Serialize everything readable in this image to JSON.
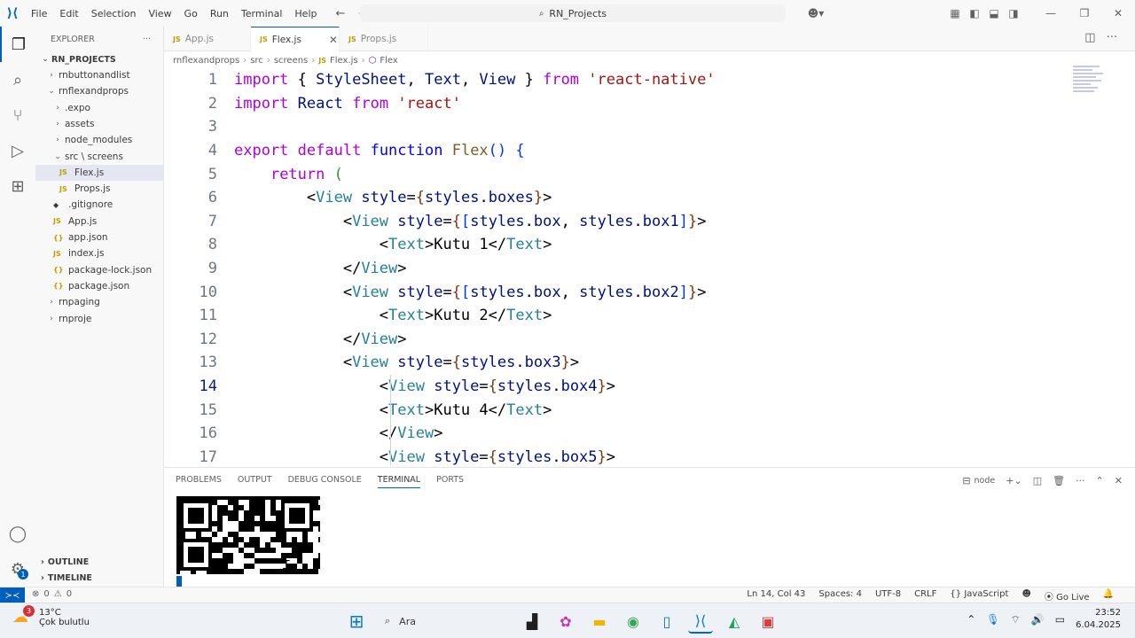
{
  "titlebar": {
    "menu": [
      "File",
      "Edit",
      "Selection",
      "View",
      "Go",
      "Run",
      "Terminal",
      "Help"
    ],
    "search": "RN_Projects"
  },
  "sidebar": {
    "title": "EXPLORER",
    "more": "···",
    "root": "RN_PROJECTS",
    "items": [
      {
        "label": "rnbuttonandlist",
        "indent": 1,
        "chev": "›"
      },
      {
        "label": "rnflexandprops",
        "indent": 1,
        "chev": "⌄"
      },
      {
        "label": ".expo",
        "indent": 2,
        "chev": "›"
      },
      {
        "label": "assets",
        "indent": 2,
        "chev": "›"
      },
      {
        "label": "node_modules",
        "indent": 2,
        "chev": "›"
      },
      {
        "label": "src \\ screens",
        "indent": 2,
        "chev": "⌄"
      },
      {
        "label": "Flex.js",
        "indent": 3,
        "icon": "JS",
        "active": true
      },
      {
        "label": "Props.js",
        "indent": 3,
        "icon": "JS"
      },
      {
        "label": ".gitignore",
        "indent": 2,
        "icon": "◆"
      },
      {
        "label": "App.js",
        "indent": 2,
        "icon": "JS"
      },
      {
        "label": "app.json",
        "indent": 2,
        "icon": "{}"
      },
      {
        "label": "index.js",
        "indent": 2,
        "icon": "JS"
      },
      {
        "label": "package-lock.json",
        "indent": 2,
        "icon": "{}"
      },
      {
        "label": "package.json",
        "indent": 2,
        "icon": "{}"
      },
      {
        "label": "rnpaging",
        "indent": 1,
        "chev": "›"
      },
      {
        "label": "rnproje",
        "indent": 1,
        "chev": "›"
      }
    ],
    "outline": "OUTLINE",
    "timeline": "TIMELINE"
  },
  "tabs": [
    {
      "label": "App.js",
      "icon": "JS",
      "active": false
    },
    {
      "label": "Flex.js",
      "icon": "JS",
      "active": true,
      "close": "✕"
    },
    {
      "label": "Props.js",
      "icon": "JS",
      "active": false
    }
  ],
  "breadcrumb": [
    "rnflexandprops",
    "src",
    "screens",
    "Flex.js",
    "Flex"
  ],
  "breadcrumb_icon": "JS",
  "editor": {
    "current_line": 14,
    "lines": [
      [
        [
          "kw",
          "import"
        ],
        [
          "pl",
          " { "
        ],
        [
          "var",
          "StyleSheet"
        ],
        [
          "pl",
          ", "
        ],
        [
          "var",
          "Text"
        ],
        [
          "pl",
          ", "
        ],
        [
          "var",
          "View"
        ],
        [
          "pl",
          " } "
        ],
        [
          "kw",
          "from"
        ],
        [
          "pl",
          " "
        ],
        [
          "str",
          "'react-native'"
        ]
      ],
      [
        [
          "kw",
          "import"
        ],
        [
          "pl",
          " "
        ],
        [
          "var",
          "React"
        ],
        [
          "pl",
          " "
        ],
        [
          "kw",
          "from"
        ],
        [
          "pl",
          " "
        ],
        [
          "str",
          "'react'"
        ]
      ],
      [],
      [
        [
          "kw",
          "export"
        ],
        [
          "pl",
          " "
        ],
        [
          "kw",
          "default"
        ],
        [
          "pl",
          " "
        ],
        [
          "kwb",
          "function"
        ],
        [
          "pl",
          " "
        ],
        [
          "fn",
          "Flex"
        ],
        [
          "br",
          "()"
        ],
        [
          "pl",
          " "
        ],
        [
          "br",
          "{"
        ]
      ],
      [
        [
          "pl",
          "    "
        ],
        [
          "kw",
          "return"
        ],
        [
          "pl",
          " "
        ],
        [
          "br2",
          "("
        ]
      ],
      [
        [
          "pl",
          "        "
        ],
        [
          "pl",
          "<"
        ],
        [
          "tag",
          "View"
        ],
        [
          "pl",
          " "
        ],
        [
          "var",
          "style"
        ],
        [
          "pl",
          "="
        ],
        [
          "br3",
          "{"
        ],
        [
          "var",
          "styles"
        ],
        [
          "pl",
          "."
        ],
        [
          "var",
          "boxes"
        ],
        [
          "br3",
          "}"
        ],
        [
          "pl",
          ">"
        ]
      ],
      [
        [
          "pl",
          "            "
        ],
        [
          "pl",
          "<"
        ],
        [
          "tag",
          "View"
        ],
        [
          "pl",
          " "
        ],
        [
          "var",
          "style"
        ],
        [
          "pl",
          "="
        ],
        [
          "br3",
          "{"
        ],
        [
          "br",
          "["
        ],
        [
          "var",
          "styles"
        ],
        [
          "pl",
          "."
        ],
        [
          "var",
          "box"
        ],
        [
          "pl",
          ", "
        ],
        [
          "var",
          "styles"
        ],
        [
          "pl",
          "."
        ],
        [
          "var",
          "box1"
        ],
        [
          "br",
          "]"
        ],
        [
          "br3",
          "}"
        ],
        [
          "pl",
          ">"
        ]
      ],
      [
        [
          "pl",
          "                "
        ],
        [
          "pl",
          "<"
        ],
        [
          "tag",
          "Text"
        ],
        [
          "pl",
          ">"
        ],
        [
          "txt",
          "Kutu 1"
        ],
        [
          "pl",
          "</"
        ],
        [
          "tag",
          "Text"
        ],
        [
          "pl",
          ">"
        ]
      ],
      [
        [
          "pl",
          "            "
        ],
        [
          "pl",
          "</"
        ],
        [
          "tag",
          "View"
        ],
        [
          "pl",
          ">"
        ]
      ],
      [
        [
          "pl",
          "            "
        ],
        [
          "pl",
          "<"
        ],
        [
          "tag",
          "View"
        ],
        [
          "pl",
          " "
        ],
        [
          "var",
          "style"
        ],
        [
          "pl",
          "="
        ],
        [
          "br3",
          "{"
        ],
        [
          "br",
          "["
        ],
        [
          "var",
          "styles"
        ],
        [
          "pl",
          "."
        ],
        [
          "var",
          "box"
        ],
        [
          "pl",
          ", "
        ],
        [
          "var",
          "styles"
        ],
        [
          "pl",
          "."
        ],
        [
          "var",
          "box2"
        ],
        [
          "br",
          "]"
        ],
        [
          "br3",
          "}"
        ],
        [
          "pl",
          ">"
        ]
      ],
      [
        [
          "pl",
          "                "
        ],
        [
          "pl",
          "<"
        ],
        [
          "tag",
          "Text"
        ],
        [
          "pl",
          ">"
        ],
        [
          "txt",
          "Kutu 2"
        ],
        [
          "pl",
          "</"
        ],
        [
          "tag",
          "Text"
        ],
        [
          "pl",
          ">"
        ]
      ],
      [
        [
          "pl",
          "            "
        ],
        [
          "pl",
          "</"
        ],
        [
          "tag",
          "View"
        ],
        [
          "pl",
          ">"
        ]
      ],
      [
        [
          "pl",
          "            "
        ],
        [
          "pl",
          "<"
        ],
        [
          "tag",
          "View"
        ],
        [
          "pl",
          " "
        ],
        [
          "var",
          "style"
        ],
        [
          "pl",
          "="
        ],
        [
          "br3",
          "{"
        ],
        [
          "var",
          "styles"
        ],
        [
          "pl",
          "."
        ],
        [
          "var",
          "box3"
        ],
        [
          "br3",
          "}"
        ],
        [
          "pl",
          ">"
        ]
      ],
      [
        [
          "pl",
          "                "
        ],
        [
          "pl",
          "<"
        ],
        [
          "tag",
          "View"
        ],
        [
          "pl",
          " "
        ],
        [
          "var",
          "style"
        ],
        [
          "pl",
          "="
        ],
        [
          "br3",
          "{"
        ],
        [
          "var",
          "styles"
        ],
        [
          "pl",
          "."
        ],
        [
          "var",
          "box4"
        ],
        [
          "br3",
          "}"
        ],
        [
          "pl",
          ">"
        ]
      ],
      [
        [
          "pl",
          "                "
        ],
        [
          "pl",
          "<"
        ],
        [
          "tag",
          "Text"
        ],
        [
          "pl",
          ">"
        ],
        [
          "txt",
          "Kutu 4"
        ],
        [
          "pl",
          "</"
        ],
        [
          "tag",
          "Text"
        ],
        [
          "pl",
          ">"
        ]
      ],
      [
        [
          "pl",
          "                "
        ],
        [
          "pl",
          "</"
        ],
        [
          "tag",
          "View"
        ],
        [
          "pl",
          ">"
        ]
      ],
      [
        [
          "pl",
          "                "
        ],
        [
          "pl",
          "<"
        ],
        [
          "tag",
          "View"
        ],
        [
          "pl",
          " "
        ],
        [
          "var",
          "style"
        ],
        [
          "pl",
          "="
        ],
        [
          "br3",
          "{"
        ],
        [
          "var",
          "styles"
        ],
        [
          "pl",
          "."
        ],
        [
          "var",
          "box5"
        ],
        [
          "br3",
          "}"
        ],
        [
          "pl",
          ">"
        ]
      ]
    ]
  },
  "panel": {
    "tabs": [
      "PROBLEMS",
      "OUTPUT",
      "DEBUG CONSOLE",
      "TERMINAL",
      "PORTS"
    ],
    "active_tab": "TERMINAL",
    "terminal_name": "node"
  },
  "statusbar": {
    "errors": "0",
    "warnings": "0",
    "position": "Ln 14, Col 43",
    "spaces": "Spaces: 4",
    "encoding": "UTF-8",
    "eol": "CRLF",
    "language": "JavaScript",
    "golive": "Go Live"
  },
  "taskbar": {
    "temp": "13°C",
    "weather": "Çok bulutlu",
    "weather_badge": "3",
    "search": "Ara",
    "time": "23:52",
    "date": "6.04.2025"
  },
  "colors": {
    "accent": "#005fb8",
    "keyword": "#af00db",
    "string": "#a31515",
    "tag": "#267f99",
    "variable": "#001080"
  }
}
